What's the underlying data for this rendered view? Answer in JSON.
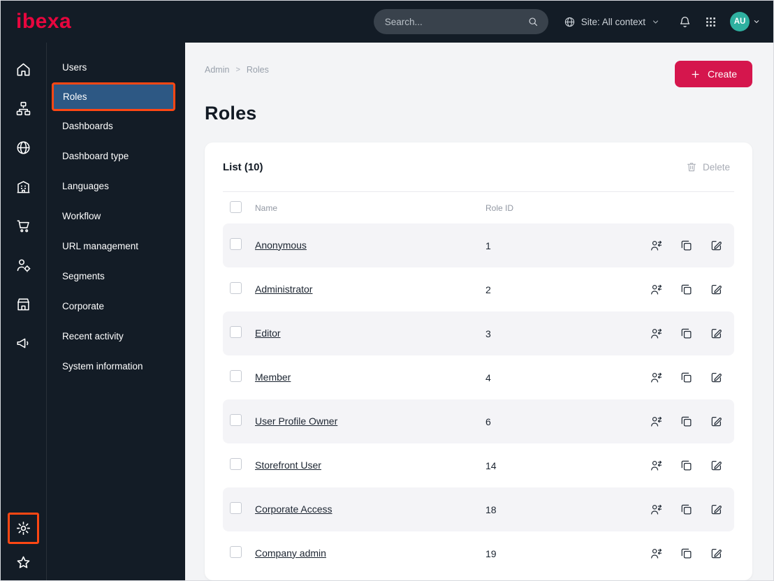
{
  "app": {
    "logo_text": "ibexa"
  },
  "topbar": {
    "search_placeholder": "Search...",
    "site_label": "Site: All context",
    "avatar_initials": "AU"
  },
  "icon_rail": {
    "top": [
      "home",
      "content-tree",
      "globe",
      "building",
      "cart",
      "user-settings",
      "storefront",
      "megaphone"
    ],
    "bottom": [
      "gear",
      "star"
    ],
    "highlighted": "gear"
  },
  "sidebar": {
    "items": [
      {
        "label": "Users",
        "active": false
      },
      {
        "label": "Roles",
        "active": true
      },
      {
        "label": "Dashboards",
        "active": false
      },
      {
        "label": "Dashboard type",
        "active": false
      },
      {
        "label": "Languages",
        "active": false
      },
      {
        "label": "Workflow",
        "active": false
      },
      {
        "label": "URL management",
        "active": false
      },
      {
        "label": "Segments",
        "active": false
      },
      {
        "label": "Corporate",
        "active": false
      },
      {
        "label": "Recent activity",
        "active": false
      },
      {
        "label": "System information",
        "active": false
      }
    ]
  },
  "page": {
    "breadcrumb": {
      "items": [
        "Admin",
        "Roles"
      ],
      "separator": ">"
    },
    "title": "Roles",
    "create_button": "Create"
  },
  "list": {
    "header": "List (10)",
    "delete_button": "Delete",
    "columns": {
      "name": "Name",
      "role_id": "Role ID"
    },
    "row_actions": [
      "assign",
      "copy",
      "edit"
    ],
    "rows": [
      {
        "name": "Anonymous",
        "role_id": "1"
      },
      {
        "name": "Administrator",
        "role_id": "2"
      },
      {
        "name": "Editor",
        "role_id": "3"
      },
      {
        "name": "Member",
        "role_id": "4"
      },
      {
        "name": "User Profile Owner",
        "role_id": "6"
      },
      {
        "name": "Storefront User",
        "role_id": "14"
      },
      {
        "name": "Corporate Access",
        "role_id": "18"
      },
      {
        "name": "Company admin",
        "role_id": "19"
      }
    ]
  },
  "colors": {
    "dark": "#131c26",
    "red": "#d5164d",
    "logo": "#e8063e",
    "orange": "#ff4713",
    "blue": "#2d5884",
    "teal": "#2fb0a0",
    "main_bg": "#f3f4f6",
    "row_alt": "#f4f4f7"
  }
}
